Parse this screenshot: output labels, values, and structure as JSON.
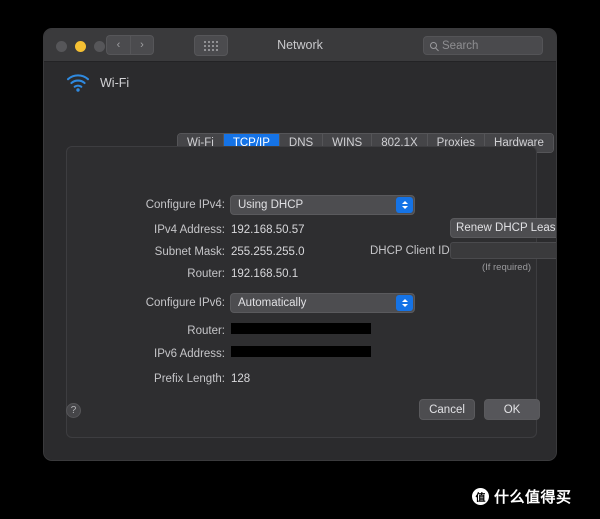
{
  "window": {
    "title": "Network",
    "traffic_lights": [
      {
        "name": "close",
        "color": "#565659"
      },
      {
        "name": "minimize",
        "color": "#f5c033"
      },
      {
        "name": "maximize",
        "color": "#565659"
      }
    ],
    "nav": {
      "back": "‹",
      "forward": "›"
    },
    "grid_button": "grid-view-icon"
  },
  "search": {
    "placeholder": "Search",
    "value": ""
  },
  "service": {
    "icon": "wifi-icon",
    "label": "Wi-Fi"
  },
  "tabs": [
    {
      "label": "Wi-Fi",
      "selected": false
    },
    {
      "label": "TCP/IP",
      "selected": true
    },
    {
      "label": "DNS",
      "selected": false
    },
    {
      "label": "WINS",
      "selected": false
    },
    {
      "label": "802.1X",
      "selected": false
    },
    {
      "label": "Proxies",
      "selected": false
    },
    {
      "label": "Hardware",
      "selected": false
    }
  ],
  "ipv4": {
    "configure_label": "Configure IPv4:",
    "configure_value": "Using DHCP",
    "address_label": "IPv4 Address:",
    "address_value": "192.168.50.57",
    "subnet_label": "Subnet Mask:",
    "subnet_value": "255.255.255.0",
    "router_label": "Router:",
    "router_value": "192.168.50.1"
  },
  "dhcp": {
    "renew_button": "Renew DHCP Lease",
    "client_id_label": "DHCP Client ID:",
    "client_id_value": "",
    "hint": "(If required)"
  },
  "ipv6": {
    "configure_label": "Configure IPv6:",
    "configure_value": "Automatically",
    "router_label": "Router:",
    "router_value": "",
    "router_redacted": true,
    "address_label": "IPv6 Address:",
    "address_value": "",
    "address_redacted": true,
    "prefix_label": "Prefix Length:",
    "prefix_value": "128"
  },
  "footer": {
    "help": "?",
    "cancel": "Cancel",
    "ok": "OK"
  },
  "watermark": {
    "badge": "值",
    "text": "什么值得买"
  },
  "colors": {
    "accent": "#1573e6",
    "window_bg": "#2b2b2d",
    "titlebar_bg": "#3a3a3c",
    "panel_bg": "#2e2e30",
    "desktop_bg": "#000000",
    "wifi_icon": "#2f8ae0"
  }
}
